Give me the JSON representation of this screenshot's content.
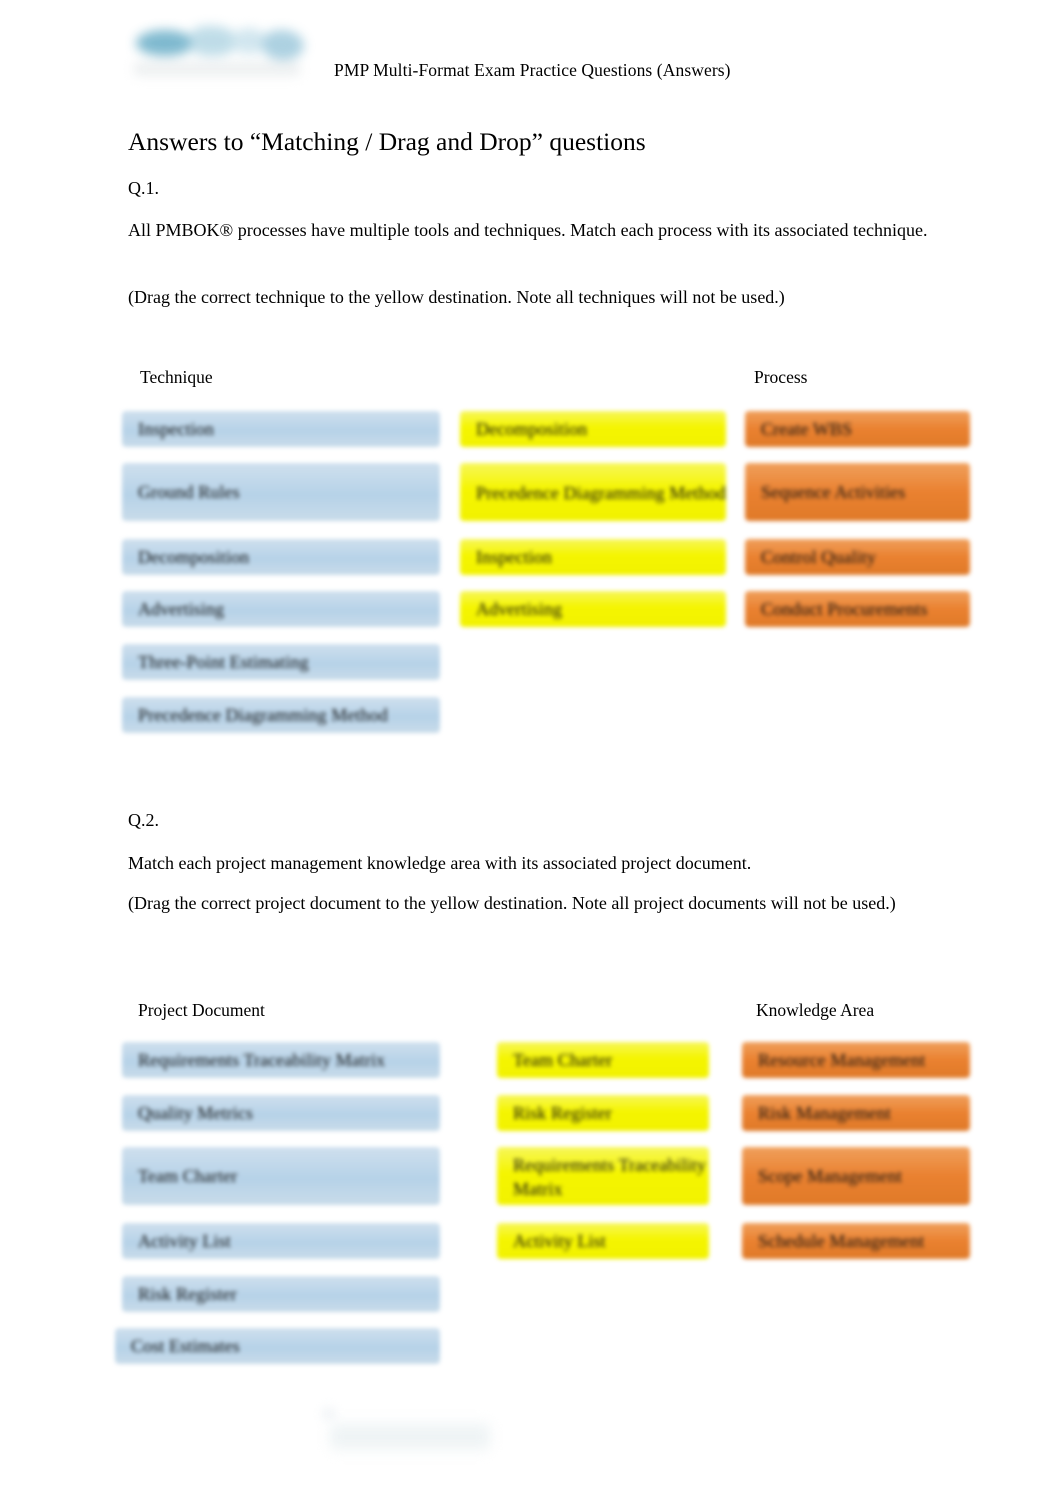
{
  "header": {
    "logo_icon": "brand-logo-blurred",
    "title": "PMP Multi-Format Exam Practice Questions (Answers)"
  },
  "document": {
    "heading": "Answers to “Matching / Drag and Drop” questions"
  },
  "questions": [
    {
      "label": "Q.1.",
      "prompt": "All PMBOK® processes have multiple tools and techniques. Match each process with its associated technique.",
      "instruction": "(Drag the correct technique to the yellow destination. Note all techniques will not be used.)",
      "left_header": "Technique",
      "right_header": "Process",
      "source_items": [
        "Inspection",
        "Ground Rules",
        "Decomposition",
        "Advertising",
        "Three-Point Estimating",
        "Precedence Diagramming Method"
      ],
      "answer_items": [
        "Decomposition",
        "Precedence Diagramming Method",
        "Inspection",
        "Advertising"
      ],
      "target_items": [
        "Create WBS",
        "Sequence Activities",
        "Control Quality",
        "Conduct Procurements"
      ]
    },
    {
      "label": "Q.2.",
      "prompt": "Match each project management knowledge area with its associated project document.",
      "instruction": "(Drag the correct project document to the yellow destination. Note all project documents will not be used.)",
      "left_header": "Project Document",
      "right_header": "Knowledge Area",
      "source_items": [
        "Requirements Traceability Matrix",
        "Quality Metrics",
        "Team Charter",
        "Activity List",
        "Risk Register",
        "Cost Estimates"
      ],
      "answer_items": [
        "Team Charter",
        "Risk Register",
        "Requirements Traceability Matrix",
        "Activity List"
      ],
      "target_items": [
        "Resource Management",
        "Risk Management",
        "Scope Management",
        "Schedule Management"
      ]
    }
  ],
  "colors": {
    "source_box": "#b6d2e8",
    "answer_box": "#f2f200",
    "target_box": "#ea8130",
    "text": "#000000",
    "page_background": "#ffffff"
  }
}
